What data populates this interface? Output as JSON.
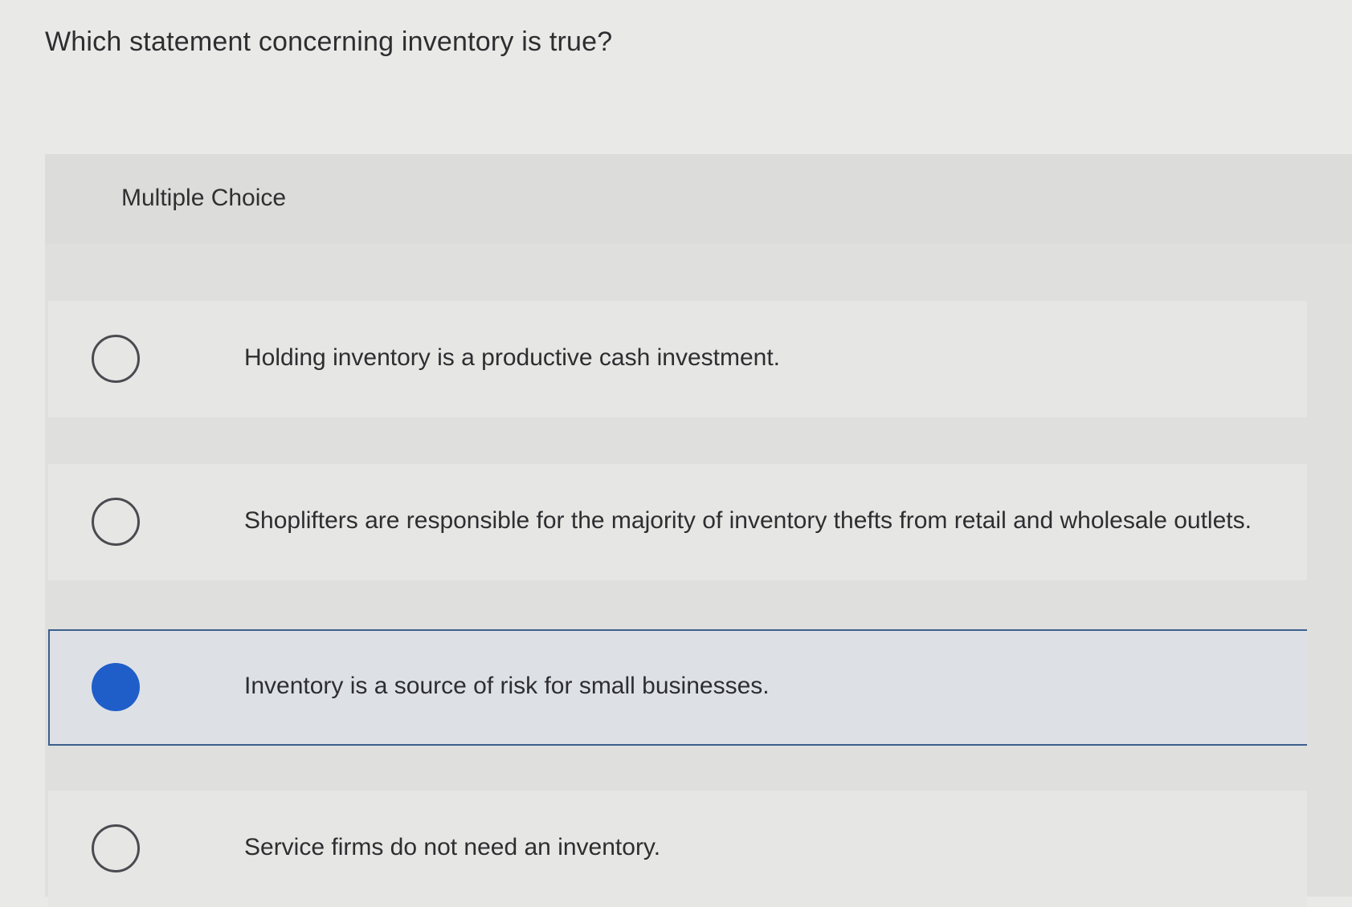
{
  "question": {
    "text": "Which statement concerning inventory is true?"
  },
  "panel": {
    "header_label": "Multiple Choice"
  },
  "options": [
    {
      "text": "Holding inventory is a productive cash investment.",
      "selected": false
    },
    {
      "text": "Shoplifters are responsible for the majority of inventory thefts from retail and wholesale outlets.",
      "selected": false
    },
    {
      "text": "Inventory is a source of risk for small businesses.",
      "selected": true
    },
    {
      "text": "Service firms do not need an inventory.",
      "selected": false
    }
  ],
  "colors": {
    "selected_radio": "#1f5ec8",
    "selected_border": "#3c5f8c",
    "selected_background": "#dde1e6"
  }
}
